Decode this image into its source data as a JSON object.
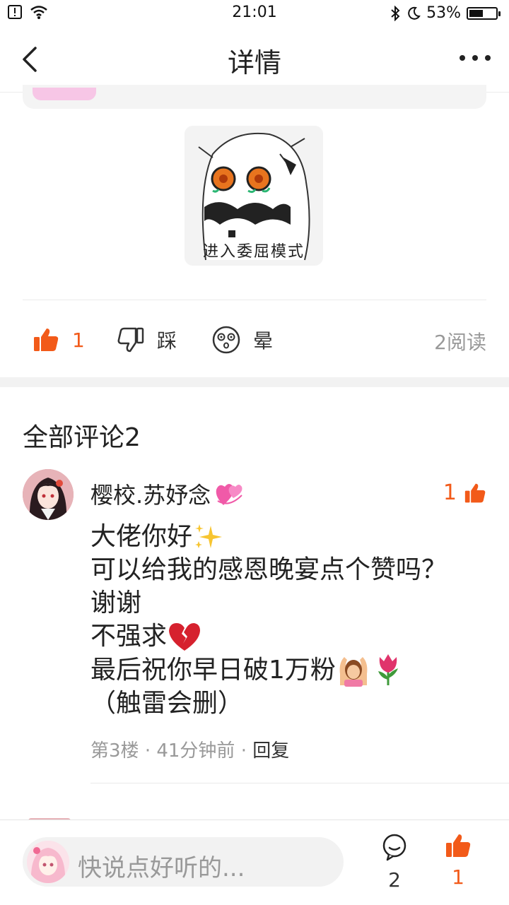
{
  "status_bar": {
    "time": "21:01",
    "battery_text": "53%",
    "battery_level": 0.53
  },
  "nav": {
    "title": "详情"
  },
  "sticker": {
    "caption": "进入委屈模式"
  },
  "actions": {
    "like_count": "1",
    "dislike_label": "踩",
    "dizzy_label": "晕",
    "read_count": "2阅读"
  },
  "comments": {
    "title": "全部评论2",
    "items": [
      {
        "username": "樱校.苏妤念",
        "like_count": "1",
        "lines": [
          "大佬你好",
          "可以给我的感恩晚宴点个赞吗？",
          "谢谢",
          "不强求",
          "最后祝你早日破1万粉",
          "（触雷会删）"
        ],
        "meta_floor": "第3楼",
        "meta_time": "41分钟前",
        "meta_reply": "回复"
      }
    ]
  },
  "bottom_bar": {
    "input_placeholder": "快说点好听的...",
    "comment_count": "2",
    "like_count": "1"
  },
  "colors": {
    "accent": "#f25a19",
    "muted": "#999999",
    "text": "#222222"
  }
}
